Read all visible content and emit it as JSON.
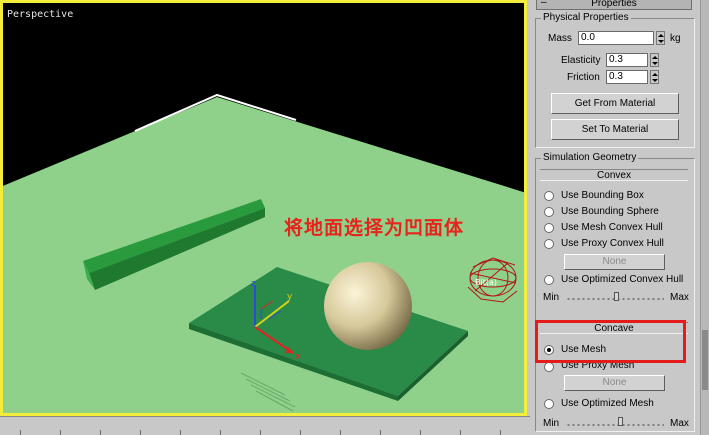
{
  "viewport": {
    "label": "Perspective",
    "annotation": "将地面选择为凹面体"
  },
  "panel": {
    "properties_title": "Properties",
    "collapse_symbol": "–",
    "physical": {
      "group_label": "Physical Properties",
      "mass_label": "Mass",
      "mass_value": "0.0",
      "mass_unit": "kg",
      "elasticity_label": "Elasticity",
      "elasticity_value": "0.3",
      "friction_label": "Friction",
      "friction_value": "0.3",
      "get_material": "Get From Material",
      "set_material": "Set To Material"
    },
    "simulation": {
      "group_label": "Simulation Geometry",
      "convex_header": "Convex",
      "options": [
        "Use Bounding Box",
        "Use Bounding Sphere",
        "Use Mesh Convex Hull",
        "Use Proxy Convex Hull"
      ],
      "none_button": "None",
      "optimized_convex": "Use Optimized Convex Hull",
      "min_label": "Min",
      "max_label": "Max",
      "concave_header": "Concave",
      "use_mesh": "Use Mesh",
      "use_proxy_mesh": "Use Proxy Mesh",
      "none_button2": "None",
      "optimized_mesh": "Use Optimized Mesh",
      "min_label2": "Min",
      "max_label2": "Max"
    }
  },
  "colors": {
    "viewport_border": "#f2ee3a",
    "ground": "#8fd18a",
    "slab": "#2a8a47",
    "annotation": "#e8231c",
    "highlight": "#e31b1b"
  }
}
